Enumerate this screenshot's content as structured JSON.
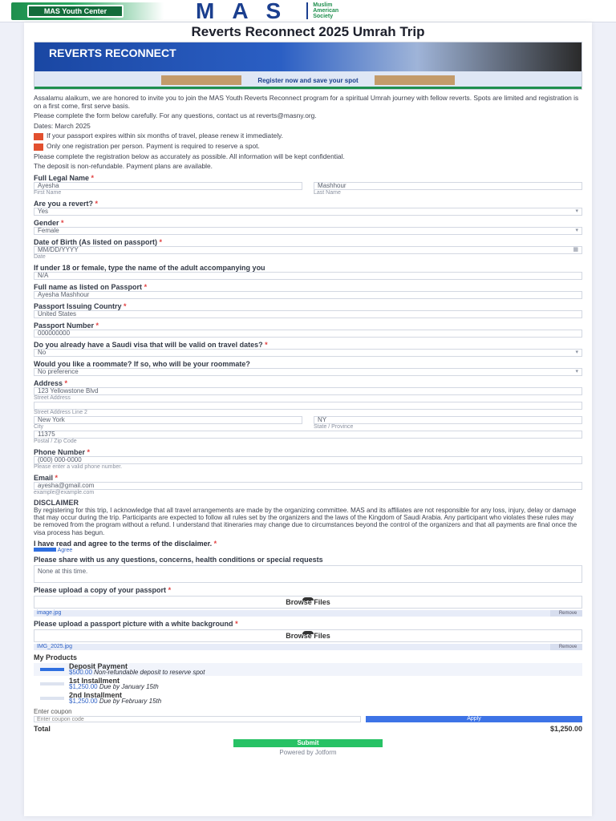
{
  "header": {
    "logo_left": "MAS Youth Center",
    "logo_main": "MAS",
    "logo_sub": [
      "Muslim",
      "American",
      "Society"
    ]
  },
  "form": {
    "title": "Reverts Reconnect 2025 Umrah Trip",
    "banner_title": "REVERTS RECONNECT",
    "banner_caption": "Register now and save your spot",
    "intro": [
      "Assalamu alaikum, we are honored to invite you to join the MAS Youth Reverts Reconnect program for a spiritual Umrah journey with fellow reverts. Spots are limited and registration is on a first come, first serve basis.",
      "Please complete the form below carefully. For any questions, contact us at reverts@masny.org.",
      "Dates: March 2025"
    ],
    "warnings": [
      "If your passport expires within six months of travel, please renew it immediately.",
      "Only one registration per person. Payment is required to reserve a spot."
    ],
    "notes": [
      "Please complete the registration below as accurately as possible. All information will be kept confidential.",
      "The deposit is non-refundable. Payment plans are available."
    ],
    "fields": {
      "full_name_label": "Full Legal Name",
      "first_name_value": "Ayesha",
      "first_name_sub": "First Name",
      "last_name_value": "Mashhour",
      "last_name_sub": "Last Name",
      "revert_label": "Are you a revert?",
      "revert_value": "Yes",
      "gender_label": "Gender",
      "gender_value": "Female",
      "dob_label": "Date of Birth (As listed on passport)",
      "dob_value": "MM/DD/YYYY",
      "dob_sub": "Date",
      "mahram_label": "If under 18 or female, type the name of the adult accompanying you",
      "mahram_value": "N/A",
      "passport_name_label": "Full name as listed on Passport",
      "passport_name_value": "Ayesha Mashhour",
      "country_label": "Passport Issuing Country",
      "country_value": "United States",
      "passport_number_label": "Passport Number",
      "passport_number_value": "000000000",
      "visa_label": "Do you already have a Saudi visa that will be valid on travel dates?",
      "visa_value": "No",
      "roommate_label": "Would you like a roommate? If so, who will be your roommate?",
      "roommate_value": "No preference",
      "address_label": "Address",
      "street_value": "123 Yellowstone Blvd",
      "street_sub": "Street Address",
      "street2_sub": "Street Address Line 2",
      "city_value": "New York",
      "city_sub": "City",
      "state_value": "NY",
      "state_sub": "State / Province",
      "zip_value": "11375",
      "zip_sub": "Postal / Zip Code",
      "phone_label": "Phone Number",
      "phone_value": "(000) 000-0000",
      "phone_sub": "Please enter a valid phone number.",
      "email_label": "Email",
      "email_value": "ayesha@gmail.com",
      "email_sub": "example@example.com"
    },
    "disclaimer_title": "DISCLAIMER",
    "disclaimer_text": "By registering for this trip, I acknowledge that all travel arrangements are made by the organizing committee. MAS and its affiliates are not responsible for any loss, injury, delay or damage that may occur during the trip. Participants are expected to follow all rules set by the organizers and the laws of the Kingdom of Saudi Arabia. Any participant who violates these rules may be removed from the program without a refund. I understand that itineraries may change due to circumstances beyond the control of the organizers and that all payments are final once the visa process has begun.",
    "agree_text": "I have read and agree to the terms of the disclaimer.",
    "agree_checkbox": "Agree",
    "concerns_label": "Please share with us any questions, concerns, health conditions or special requests",
    "concerns_value": "None at this time.",
    "upload_passport_label": "Please upload a copy of your passport",
    "upload_button": "Browse Files",
    "upload_passport_file": "image.jpg",
    "upload_photo_label": "Please upload a passport picture with a white background",
    "upload_photo_file": "IMG_2025.jpg",
    "remove_label": "Remove",
    "products_title": "My Products",
    "products": [
      {
        "name": "Deposit Payment",
        "desc": "Non-refundable deposit to reserve spot",
        "price": "$500.00"
      },
      {
        "name": "1st Installment",
        "desc": "Due by January 15th",
        "price": "$1,250.00"
      },
      {
        "name": "2nd Installment",
        "desc": "Due by February 15th",
        "price": "$1,250.00"
      }
    ],
    "coupon_label": "Enter coupon",
    "coupon_placeholder": "Enter coupon code",
    "coupon_button": "Apply",
    "total_label": "Total",
    "total_value": "$1,250.00",
    "submit_label": "Submit",
    "powered_by": "Powered by Jotform"
  }
}
